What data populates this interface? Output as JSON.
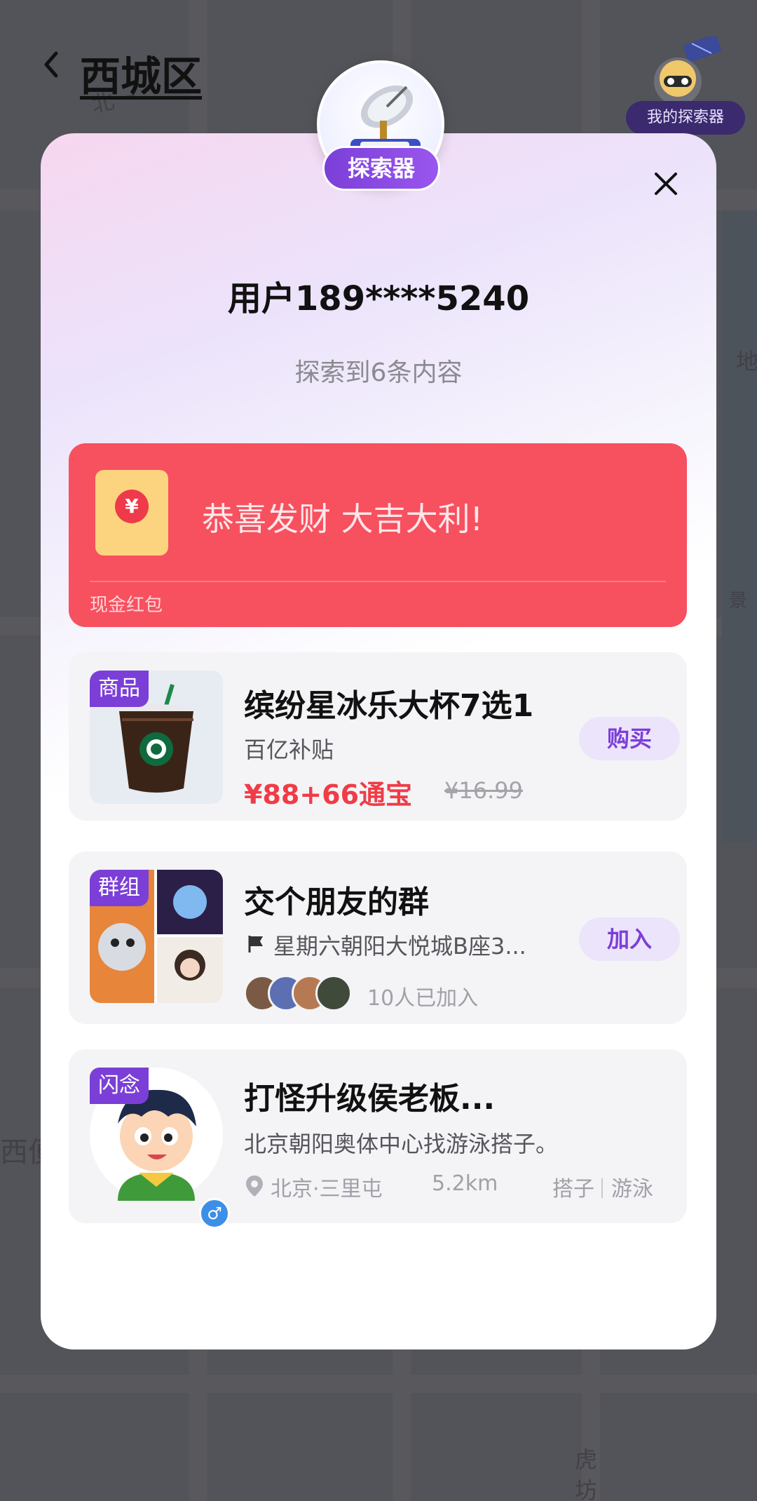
{
  "header": {
    "district_title": "西城区",
    "explorer_corner_label": "我的探索器"
  },
  "map": {
    "labels": [
      "北一",
      "地",
      "景",
      "西便",
      "虎",
      "坊"
    ]
  },
  "modal": {
    "badge_label": "探索器",
    "user_name": "用户189****5240",
    "explore_count_text": "探索到6条内容"
  },
  "red_packet": {
    "slogan": "恭喜发财 大吉大利!",
    "kind_label": "现金红包",
    "coin_symbol": "¥",
    "color": "#f7505f"
  },
  "items": [
    {
      "type_tag": "商品",
      "title": "缤纷星冰乐大杯7选1",
      "subtitle": "百亿补贴",
      "price": "¥88+66通宝",
      "original_price": "¥16.99",
      "action_label": "购买",
      "thumbnail_icon": "coffee-cup-icon"
    },
    {
      "type_tag": "群组",
      "title": "交个朋友的群",
      "location_text": "星期六朝阳大悦城B座3...",
      "members_text": "10人已加入",
      "action_label": "加入"
    },
    {
      "type_tag": "闪念",
      "title": "打怪升级侯老板...",
      "subtitle": "北京朝阳奥体中心找游泳搭子。",
      "location_text": "北京·三里屯",
      "distance": "5.2km",
      "tags": [
        "搭子",
        "游泳"
      ],
      "gender_symbol": "♂"
    }
  ],
  "colors": {
    "accent": "#7b3fd8",
    "price_red": "#f03c46",
    "card_bg": "#f4f4f6"
  }
}
